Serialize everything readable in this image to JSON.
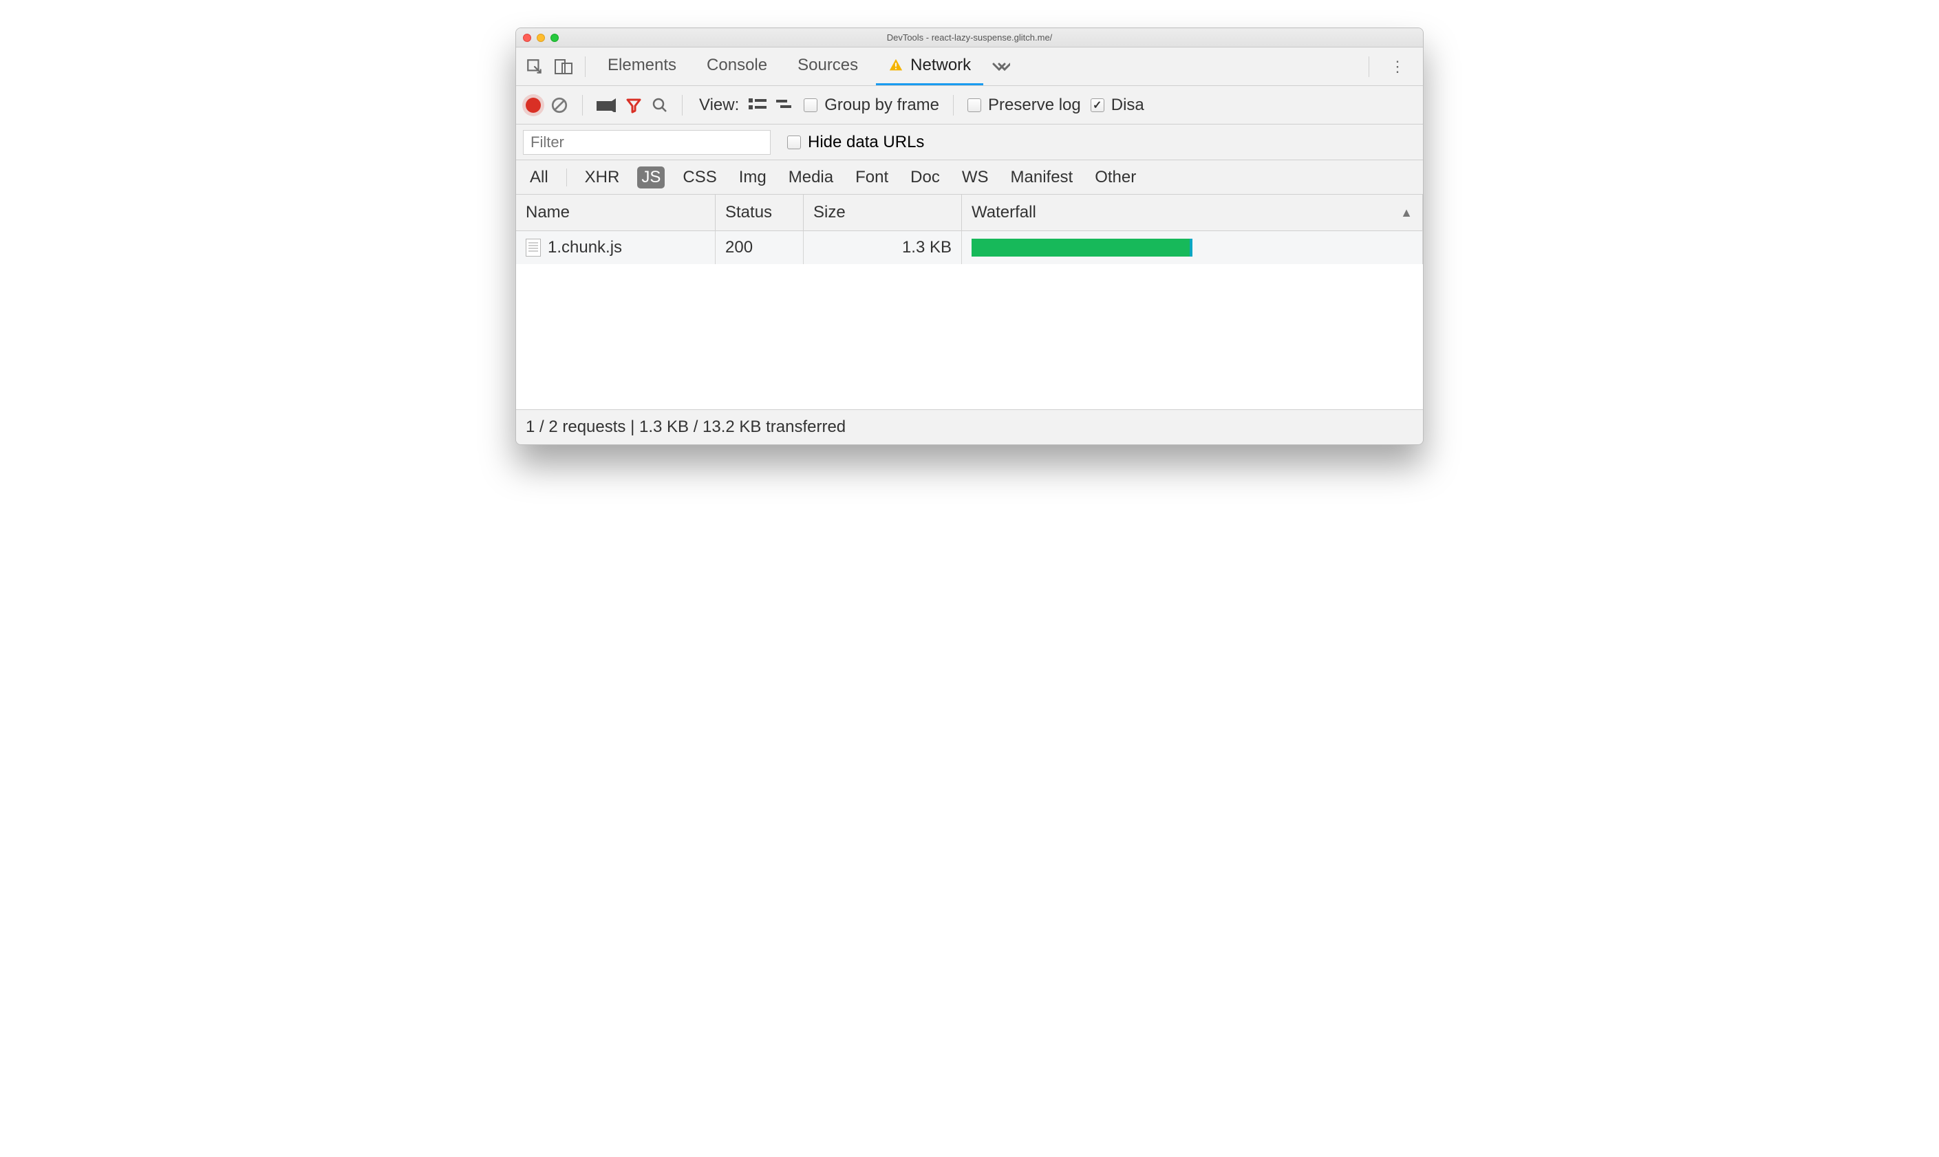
{
  "window": {
    "title": "DevTools - react-lazy-suspense.glitch.me/"
  },
  "tabs": {
    "elements": "Elements",
    "console": "Console",
    "sources": "Sources",
    "network": "Network"
  },
  "toolbar": {
    "view_label": "View:",
    "group_by_frame": "Group by frame",
    "preserve_log": "Preserve log",
    "disable_cache": "Disa"
  },
  "filter": {
    "placeholder": "Filter",
    "hide_data_urls": "Hide data URLs"
  },
  "type_filters": {
    "all": "All",
    "xhr": "XHR",
    "js": "JS",
    "css": "CSS",
    "img": "Img",
    "media": "Media",
    "font": "Font",
    "doc": "Doc",
    "ws": "WS",
    "manifest": "Manifest",
    "other": "Other"
  },
  "columns": {
    "name": "Name",
    "status": "Status",
    "size": "Size",
    "waterfall": "Waterfall"
  },
  "rows": [
    {
      "name": "1.chunk.js",
      "status": "200",
      "size": "1.3 KB"
    }
  ],
  "summary": "1 / 2 requests | 1.3 KB / 13.2 KB transferred"
}
